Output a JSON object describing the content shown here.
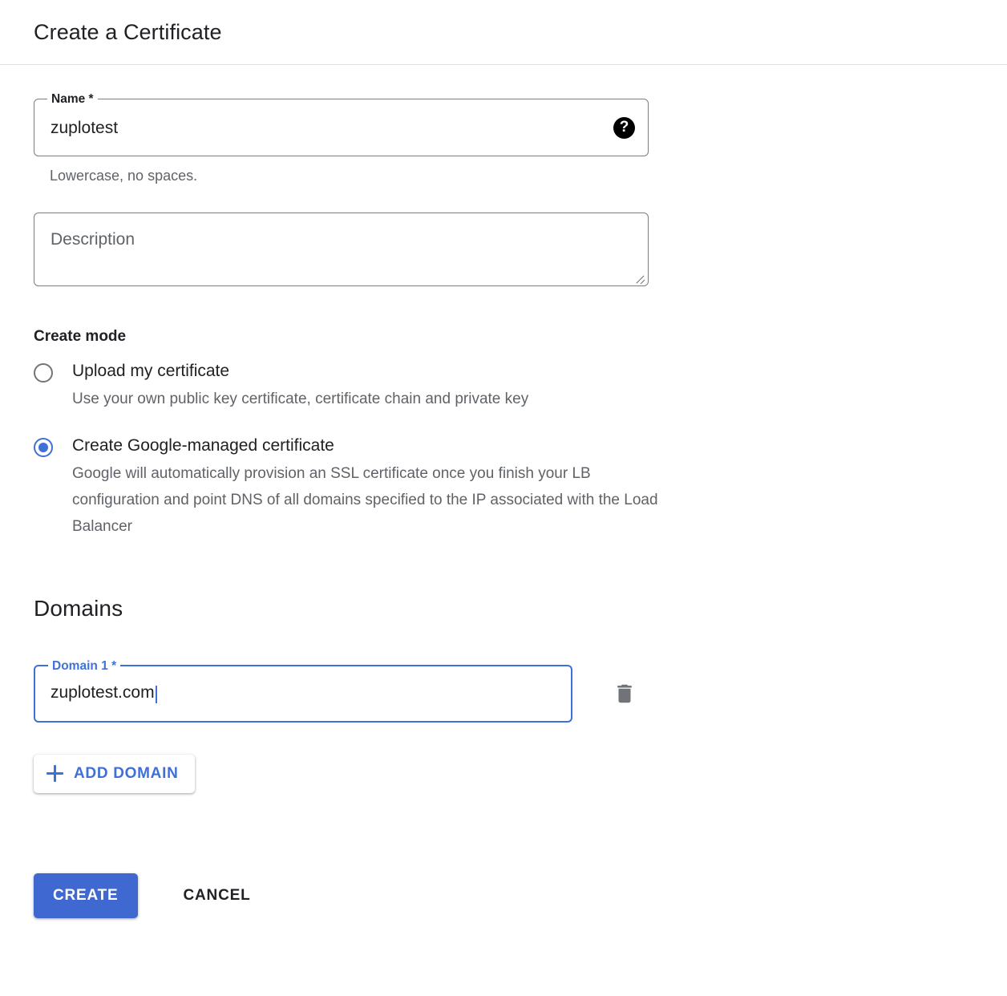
{
  "header": {
    "title": "Create a Certificate"
  },
  "name_field": {
    "label": "Name *",
    "value": "zuplotest",
    "helper": "Lowercase, no spaces.",
    "help_icon": "help-icon",
    "help_glyph": "?"
  },
  "description_field": {
    "placeholder": "Description",
    "value": ""
  },
  "create_mode": {
    "label": "Create mode",
    "options": [
      {
        "label": "Upload my certificate",
        "description": "Use your own public key certificate, certificate chain and private key",
        "selected": false
      },
      {
        "label": "Create Google-managed certificate",
        "description": "Google will automatically provision an SSL certificate once you finish your LB configuration and point DNS of all domains specified to the IP associated with the Load Balancer",
        "selected": true
      }
    ]
  },
  "domains": {
    "title": "Domains",
    "entries": [
      {
        "label": "Domain 1 *",
        "value": "zuplotest.com",
        "delete_icon": "trash-icon"
      }
    ],
    "add_button": {
      "label": "ADD DOMAIN",
      "icon": "plus-icon"
    }
  },
  "actions": {
    "create_label": "CREATE",
    "cancel_label": "CANCEL"
  },
  "colors": {
    "accent_blue": "#3f6fd8",
    "button_blue": "#3f68d0",
    "text_primary": "#202124",
    "text_secondary": "#5f6368",
    "border_gray": "#7a7d80",
    "divider": "#e0e0e0",
    "icon_gray": "#70757a"
  }
}
